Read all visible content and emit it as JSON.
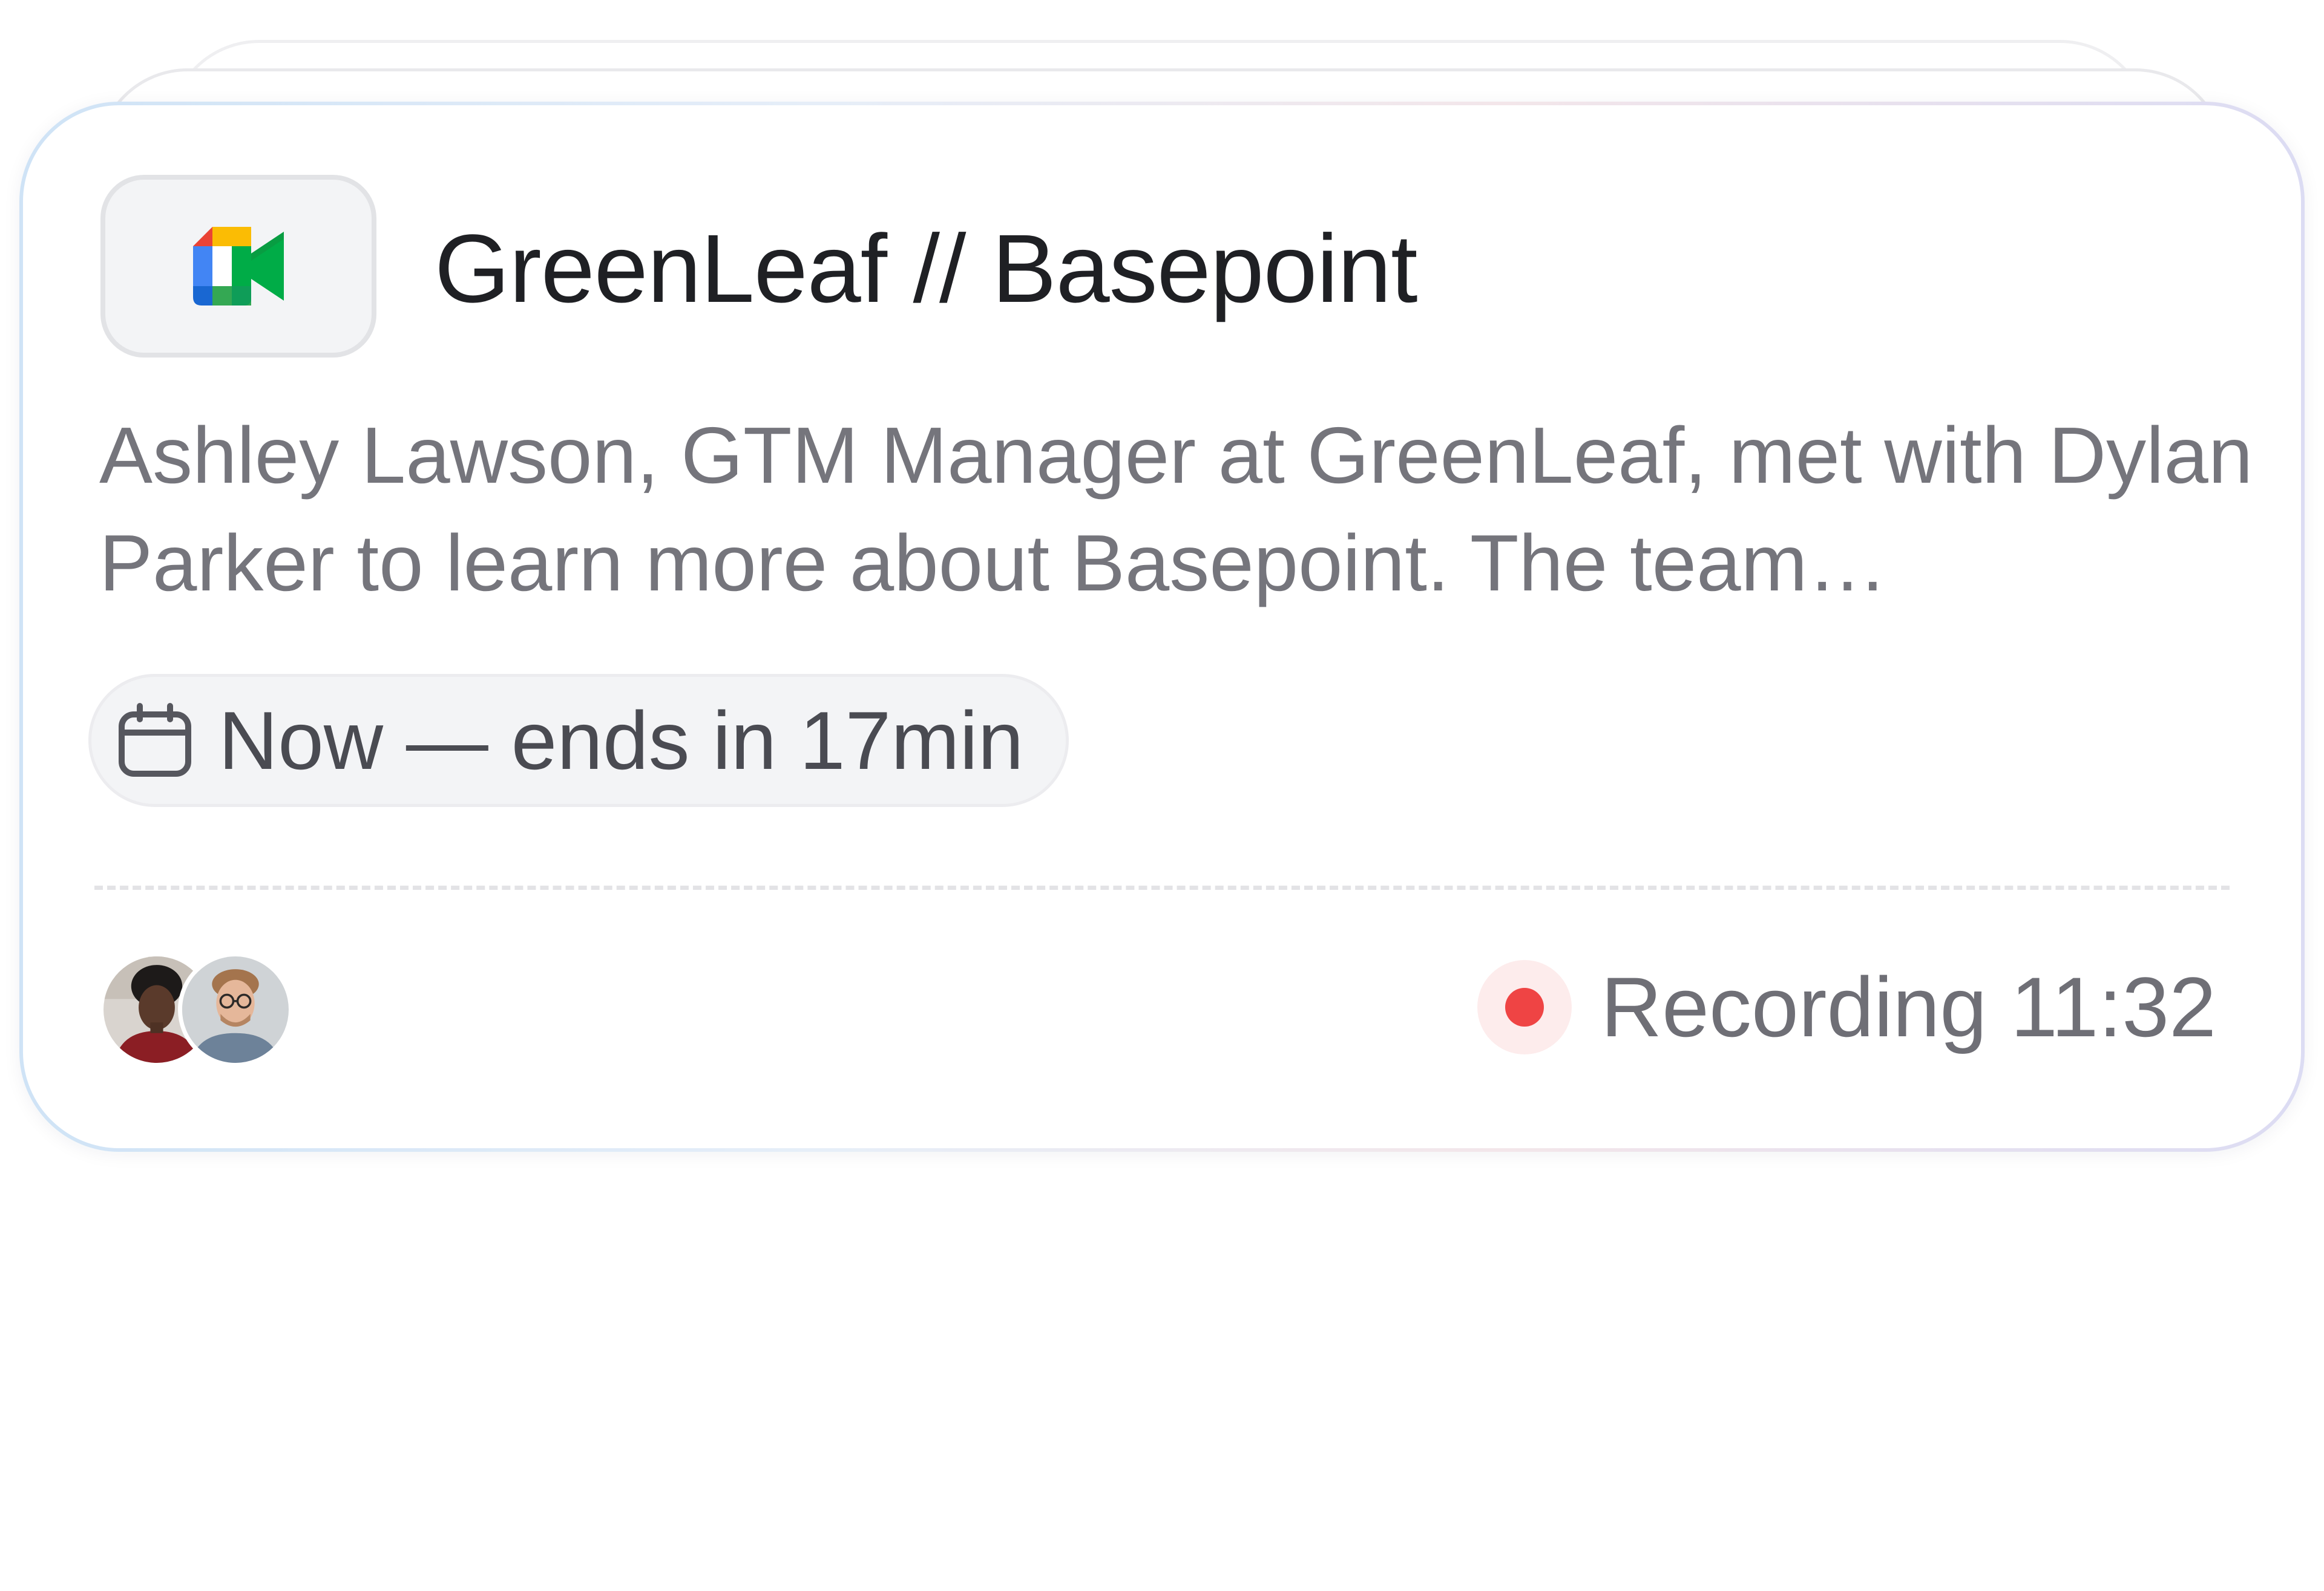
{
  "meeting_card": {
    "app_icon": "google-meet-icon",
    "title": "GreenLeaf // Basepoint",
    "description": "Ashley Lawson, GTM Manager at GreenLeaf, met with Dylan Parker to learn more about Basepoint. The team…",
    "time_chip": {
      "icon": "calendar-icon",
      "label": "Now — ends in 17min"
    },
    "participants": [
      {
        "icon": "avatar-woman"
      },
      {
        "icon": "avatar-man-glasses"
      }
    ],
    "recording": {
      "label": "Recording 11:32",
      "status_color": "#ef4444"
    }
  }
}
